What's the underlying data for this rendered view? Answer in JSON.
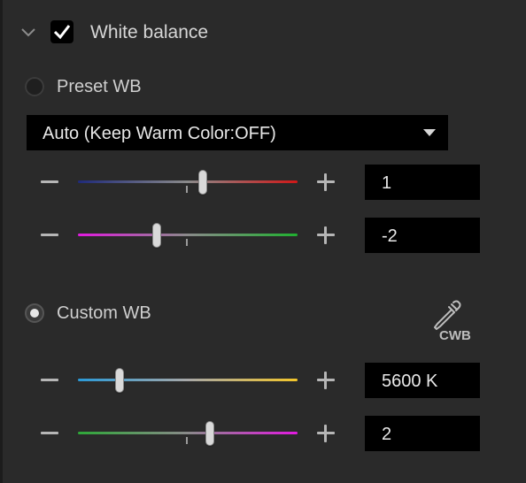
{
  "section": {
    "title": "White balance",
    "enabled": true
  },
  "preset_wb": {
    "label": "Preset WB",
    "selected": false,
    "dropdown": {
      "selected_value": "Auto (Keep Warm Color:OFF)"
    },
    "sliders": [
      {
        "id": "blue-red",
        "value": "1",
        "level": 0.57,
        "colors": [
          "#1f2a7a",
          "#8a8a8a",
          "#d01818"
        ]
      },
      {
        "id": "magenta-green",
        "value": "-2",
        "level": 0.36,
        "colors": [
          "#e21ae0",
          "#8a8a8a",
          "#20b030"
        ]
      }
    ]
  },
  "custom_wb": {
    "label": "Custom WB",
    "selected": true,
    "eyedropper": {
      "label": "CWB",
      "icon": "eyedropper-icon"
    },
    "sliders": [
      {
        "id": "temperature",
        "value": "5600 K",
        "level": 0.19,
        "colors": [
          "#2a9ad8",
          "#a8a8a8",
          "#f3c62a"
        ]
      },
      {
        "id": "tint",
        "value": "2",
        "level": 0.6,
        "colors": [
          "#2ea838",
          "#8a8a8a",
          "#e21ae0"
        ]
      }
    ]
  }
}
